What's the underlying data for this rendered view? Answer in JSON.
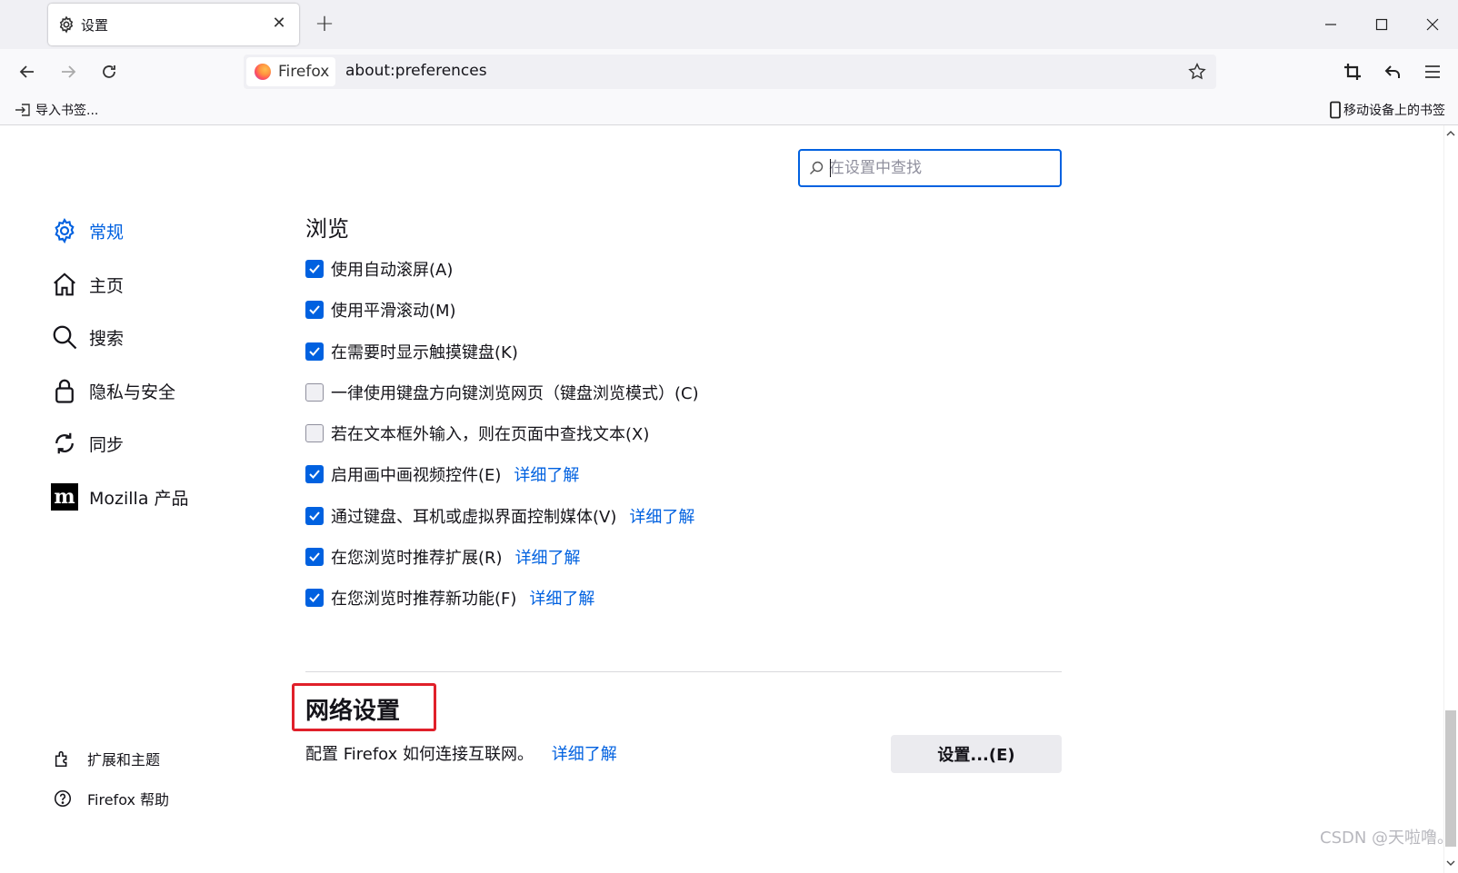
{
  "tab": {
    "title": "设置"
  },
  "navbar": {
    "identity_label": "Firefox",
    "url": "about:preferences"
  },
  "bookmarks": {
    "import_label": "导入书签...",
    "mobile_label": "移动设备上的书签"
  },
  "search": {
    "placeholder": "在设置中查找"
  },
  "sidebar": {
    "items": [
      {
        "label": "常规",
        "icon": "gear-icon",
        "selected": true
      },
      {
        "label": "主页",
        "icon": "home-icon"
      },
      {
        "label": "搜索",
        "icon": "search-icon"
      },
      {
        "label": "隐私与安全",
        "icon": "lock-icon"
      },
      {
        "label": "同步",
        "icon": "sync-icon"
      },
      {
        "label": "Mozilla 产品",
        "icon": "mozilla-icon"
      }
    ],
    "footer": [
      {
        "label": "扩展和主题",
        "icon": "puzzle-icon"
      },
      {
        "label": "Firefox 帮助",
        "icon": "help-icon"
      }
    ]
  },
  "browsing": {
    "heading": "浏览",
    "options": [
      {
        "label": "使用自动滚屏(A)",
        "checked": true
      },
      {
        "label": "使用平滑滚动(M)",
        "checked": true
      },
      {
        "label": "在需要时显示触摸键盘(K)",
        "checked": true
      },
      {
        "label": "一律使用键盘方向键浏览网页（键盘浏览模式）(C)",
        "checked": false
      },
      {
        "label": "若在文本框外输入，则在页面中查找文本(X)",
        "checked": false
      },
      {
        "label": "启用画中画视频控件(E)",
        "checked": true,
        "link": "详细了解"
      },
      {
        "label": "通过键盘、耳机或虚拟界面控制媒体(V)",
        "checked": true,
        "link": "详细了解"
      },
      {
        "label": "在您浏览时推荐扩展(R)",
        "checked": true,
        "link": "详细了解"
      },
      {
        "label": "在您浏览时推荐新功能(F)",
        "checked": true,
        "link": "详细了解"
      }
    ]
  },
  "network": {
    "heading": "网络设置",
    "description": "配置 Firefox 如何连接互联网。",
    "link": "详细了解",
    "button": "设置...(E)"
  },
  "watermark": "CSDN @天啦噜。",
  "colors": {
    "accent": "#0061e0",
    "highlight_box": "#e0202a"
  }
}
